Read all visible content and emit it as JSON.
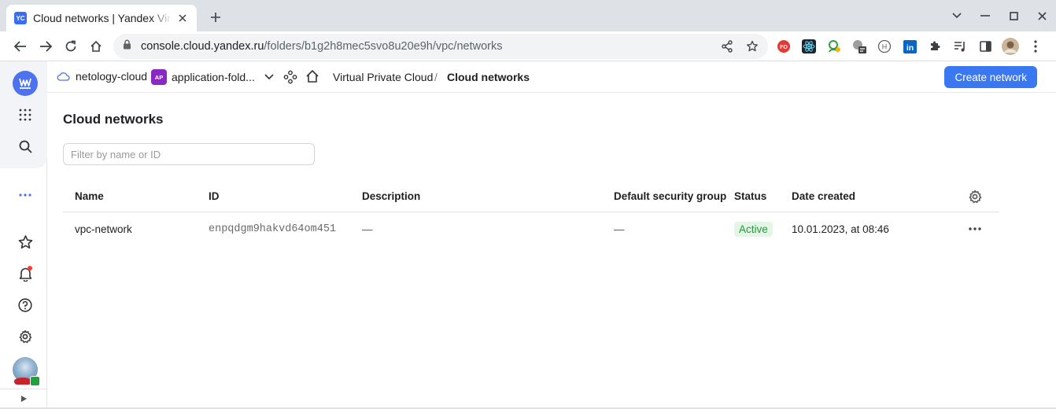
{
  "browser": {
    "tab_title": "Cloud networks | Yandex Virtual Private Cloud",
    "favicon_text": "YC",
    "url_host": "console.cloud.yandex.ru",
    "url_path": "/folders/b1g2h8mec5svo8u20e9h/vpc/networks",
    "extensions": [
      {
        "name": "fo-extension-icon",
        "text": "FO",
        "color": "#e53935"
      },
      {
        "name": "react-devtools-icon",
        "color": "#20232a"
      },
      {
        "name": "green-extension-icon",
        "color": "#2e9e44"
      },
      {
        "name": "grey-extension-icon",
        "color": "#6b6b6b"
      },
      {
        "name": "h-extension-icon",
        "text": "H"
      },
      {
        "name": "linkedin-icon",
        "text": "in",
        "color": "#0a66c2"
      }
    ]
  },
  "topbar": {
    "cloud": "netology-cloud",
    "folder_badge": "AP",
    "folder": "application-fold...",
    "service": "Virtual Private Cloud",
    "separator": "/",
    "current": "Cloud networks",
    "create_button": "Create network"
  },
  "page": {
    "title": "Cloud networks",
    "filter_placeholder": "Filter by name or ID"
  },
  "table": {
    "columns": [
      "Name",
      "ID",
      "Description",
      "Default security group",
      "Status",
      "Date created"
    ],
    "rows": [
      {
        "name": "vpc-network",
        "id": "enpqdgm9hakvd64om451",
        "description": "—",
        "security_group": "—",
        "status": "Active",
        "created": "10.01.2023, at 08:46"
      }
    ]
  },
  "colors": {
    "accent": "#3a78f2",
    "brand": "#4d72f0",
    "status_active_bg": "#e4f5e6",
    "status_active_text": "#1e9b3a",
    "folder_badge": "#8b27c4"
  }
}
